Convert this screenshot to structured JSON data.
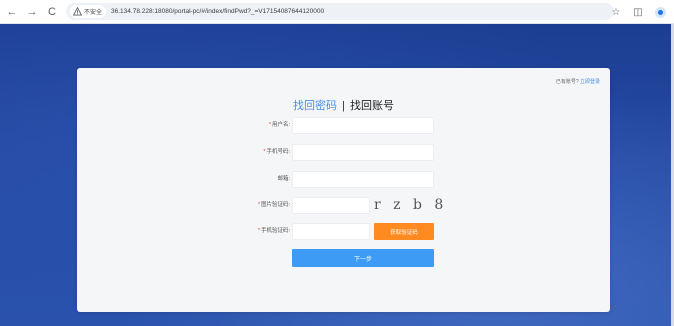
{
  "browser": {
    "back_icon": "←",
    "forward_icon": "→",
    "reload_icon": "C",
    "security_label": "不安全",
    "url": "36.134.78.228:18080/portal-pc/#/index/findPwd?_=V17154087644120000",
    "star_icon": "☆",
    "extensions_icon": "◫"
  },
  "form": {
    "has_account_text": "已有账号?",
    "login_link": "立即登录",
    "tab_find_password": "找回密码",
    "tab_separator": "|",
    "tab_find_account": "找回账号",
    "required_mark": "*",
    "username_label": "用户名:",
    "phone_label": "手机号码:",
    "email_label": "邮箱:",
    "image_code_label": "图片验证码:",
    "captcha_text": "r z b 8",
    "sms_code_label": "手机验证码:",
    "get_code_button": "获取验证码",
    "next_button": "下一步"
  },
  "colors": {
    "accent": "#4a90e2",
    "primary_button": "#3d9bf5",
    "sms_button": "#ff8a1f",
    "required": "#e53935",
    "background": "#1c3e92"
  }
}
